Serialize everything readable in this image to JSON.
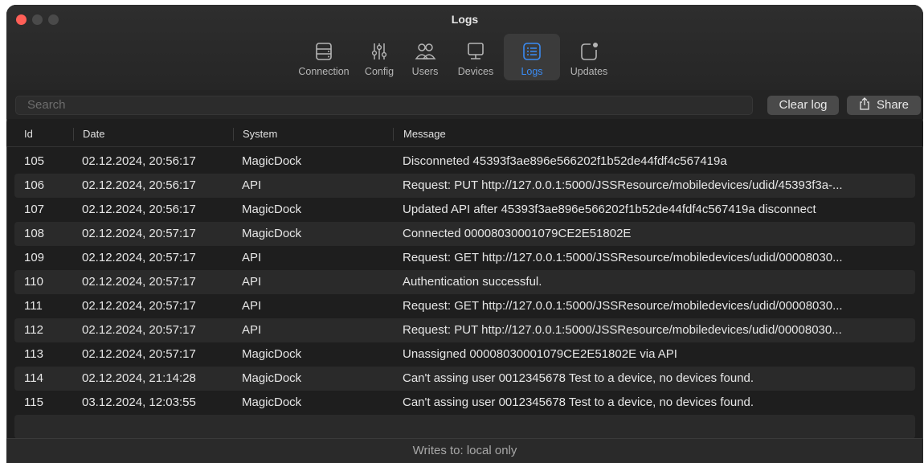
{
  "window": {
    "title": "Logs"
  },
  "toolbar": {
    "tabs": [
      {
        "label": "Connection",
        "icon": "server-icon"
      },
      {
        "label": "Config",
        "icon": "sliders-icon"
      },
      {
        "label": "Users",
        "icon": "users-icon"
      },
      {
        "label": "Devices",
        "icon": "monitor-icon"
      },
      {
        "label": "Logs",
        "icon": "logs-icon",
        "active": true
      },
      {
        "label": "Updates",
        "icon": "updates-icon"
      }
    ]
  },
  "search": {
    "placeholder": "Search"
  },
  "actions": {
    "clear_label": "Clear log",
    "share_label": "Share"
  },
  "table": {
    "columns": [
      "Id",
      "Date",
      "System",
      "Message"
    ],
    "rows": [
      {
        "id": "105",
        "date": "02.12.2024, 20:56:17",
        "system": "MagicDock",
        "message": "Disconneted 45393f3ae896e566202f1b52de44fdf4c567419a"
      },
      {
        "id": "106",
        "date": "02.12.2024, 20:56:17",
        "system": "API",
        "message": "Request: PUT http://127.0.0.1:5000/JSSResource/mobiledevices/udid/45393f3a-..."
      },
      {
        "id": "107",
        "date": "02.12.2024, 20:56:17",
        "system": "MagicDock",
        "message": "Updated API after 45393f3ae896e566202f1b52de44fdf4c567419a disconnect"
      },
      {
        "id": "108",
        "date": "02.12.2024, 20:57:17",
        "system": "MagicDock",
        "message": "Connected 00008030001079CE2E51802E"
      },
      {
        "id": "109",
        "date": "02.12.2024, 20:57:17",
        "system": "API",
        "message": "Request: GET http://127.0.0.1:5000/JSSResource/mobiledevices/udid/00008030..."
      },
      {
        "id": "110",
        "date": "02.12.2024, 20:57:17",
        "system": "API",
        "message": "Authentication successful."
      },
      {
        "id": "111",
        "date": "02.12.2024, 20:57:17",
        "system": "API",
        "message": "Request: GET http://127.0.0.1:5000/JSSResource/mobiledevices/udid/00008030..."
      },
      {
        "id": "112",
        "date": "02.12.2024, 20:57:17",
        "system": "API",
        "message": "Request: PUT http://127.0.0.1:5000/JSSResource/mobiledevices/udid/00008030..."
      },
      {
        "id": "113",
        "date": "02.12.2024, 20:57:17",
        "system": "MagicDock",
        "message": "Unassigned 00008030001079CE2E51802E via API"
      },
      {
        "id": "114",
        "date": "02.12.2024, 21:14:28",
        "system": "MagicDock",
        "message": "Can't assing user 0012345678 Test to a device, no devices found."
      },
      {
        "id": "115",
        "date": "03.12.2024, 12:03:55",
        "system": "MagicDock",
        "message": "Can't assing user 0012345678 Test to a device, no devices found."
      }
    ]
  },
  "footer": {
    "text": "Writes to: local only"
  },
  "colors": {
    "accent": "#3a8cf5",
    "close": "#ff5f57",
    "background": "#1e1e1e"
  }
}
